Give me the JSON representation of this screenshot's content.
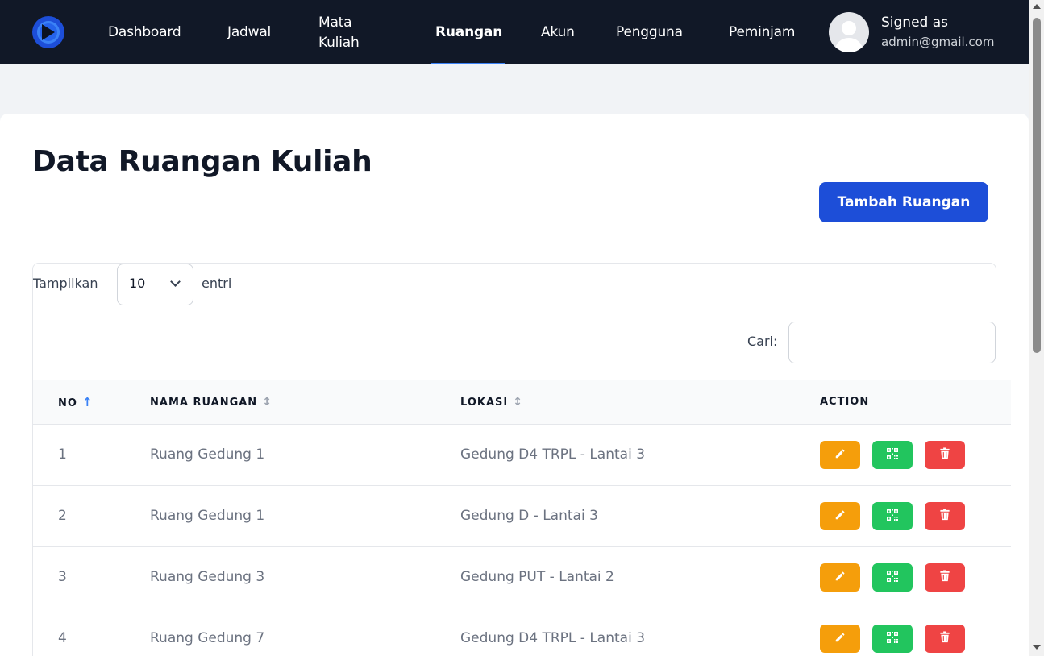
{
  "nav": {
    "items": [
      {
        "label": "Dashboard"
      },
      {
        "label": "Jadwal"
      },
      {
        "label": "Mata Kuliah"
      },
      {
        "label": "Ruangan",
        "active": true
      },
      {
        "label": "Akun"
      },
      {
        "label": "Pengguna"
      },
      {
        "label": "Peminjam"
      }
    ],
    "user": {
      "signed_as": "Signed as",
      "email": "admin@gmail.com"
    }
  },
  "page": {
    "title": "Data Ruangan Kuliah",
    "add_button": "Tambah Ruangan"
  },
  "table_controls": {
    "show_label": "Tampilkan",
    "entries_value": "10",
    "entries_label": "entri",
    "search_label": "Cari:",
    "search_value": ""
  },
  "table": {
    "headers": [
      "NO",
      "NAMA RUANGAN",
      "LOKASI",
      "ACTION"
    ],
    "sort": {
      "no": "↑",
      "other": "↕"
    },
    "rows": [
      {
        "no": "1",
        "name": "Ruang Gedung 1",
        "location": "Gedung D4 TRPL - Lantai 3"
      },
      {
        "no": "2",
        "name": "Ruang Gedung 1",
        "location": "Gedung D - Lantai 3"
      },
      {
        "no": "3",
        "name": "Ruang Gedung 3",
        "location": "Gedung PUT - Lantai 2"
      },
      {
        "no": "4",
        "name": "Ruang Gedung 7",
        "location": "Gedung D4 TRPL - Lantai 3"
      }
    ]
  },
  "colors": {
    "navbar": "#111827",
    "primary": "#1d4ed8",
    "edit": "#f59e0b",
    "qr": "#22c55e",
    "delete": "#ef4444"
  },
  "icons": {
    "logo": "play-logo-icon",
    "edit": "pencil-icon",
    "qr": "qrcode-icon",
    "delete": "trash-icon"
  }
}
